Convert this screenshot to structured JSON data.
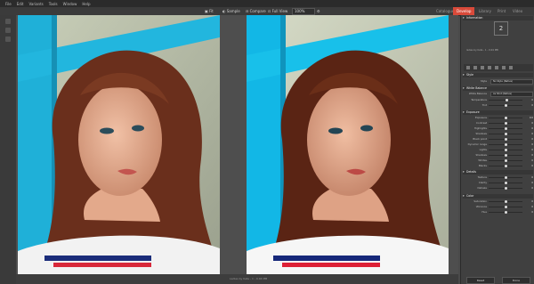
{
  "menu": [
    "File",
    "Edit",
    "Variants",
    "Tools",
    "Window",
    "Help"
  ],
  "toolbar": {
    "fit_label": "Fit",
    "sample_label": "Sample",
    "compare_label": "Compare",
    "view_label": "Full View",
    "zoom_value": "100%"
  },
  "modules": [
    "Catalogue",
    "Develop",
    "Library",
    "Print",
    "Video"
  ],
  "active_module": "Develop",
  "status_text": "Ladies by Kate - 1 - 0.04 MB",
  "panel": {
    "information_header": "Information",
    "histogram_value": "2",
    "file_info": "ladies by Kate - 1 - 0.04 MB",
    "style_header": "Style",
    "style_label": "Style",
    "style_value": "No Style (Native)",
    "white_balance_header": "White Balance",
    "white_balance_label": "White Balance",
    "white_balance_value": "As Shot (Native)",
    "wb_sliders": [
      {
        "label": "Temperature",
        "value": "0",
        "pos": 0.55
      },
      {
        "label": "Tint",
        "value": "0",
        "pos": 0.5
      }
    ],
    "exposure_header": "Exposure",
    "exposure_sliders": [
      {
        "label": "Exposure",
        "value": "0.0",
        "pos": 0.5
      },
      {
        "label": "Contrast",
        "value": "0",
        "pos": 0.5
      },
      {
        "label": "Highlights",
        "value": "0",
        "pos": 0.5
      },
      {
        "label": "Shadows",
        "value": "0",
        "pos": 0.5
      },
      {
        "label": "Black point",
        "value": "0",
        "pos": 0.5
      },
      {
        "label": "Dynamic range",
        "value": "0",
        "pos": 0.5
      },
      {
        "label": "Lights",
        "value": "0",
        "pos": 0.5
      },
      {
        "label": "Shadows",
        "value": "0",
        "pos": 0.5
      },
      {
        "label": "Whites",
        "value": "0",
        "pos": 0.5
      },
      {
        "label": "Blacks",
        "value": "0",
        "pos": 0.5
      }
    ],
    "details_header": "Details",
    "details_sliders": [
      {
        "label": "Texture",
        "value": "0",
        "pos": 0.5
      },
      {
        "label": "Clarity",
        "value": "0",
        "pos": 0.5
      },
      {
        "label": "Dehaze",
        "value": "0",
        "pos": 0.5
      }
    ],
    "color_header": "Color",
    "color_sliders": [
      {
        "label": "Saturation",
        "value": "0",
        "pos": 0.5
      },
      {
        "label": "Vibrance",
        "value": "0",
        "pos": 0.5
      },
      {
        "label": "Hue",
        "value": "0",
        "pos": 0.5
      }
    ],
    "reset_label": "Reset",
    "done_label": "Done"
  }
}
